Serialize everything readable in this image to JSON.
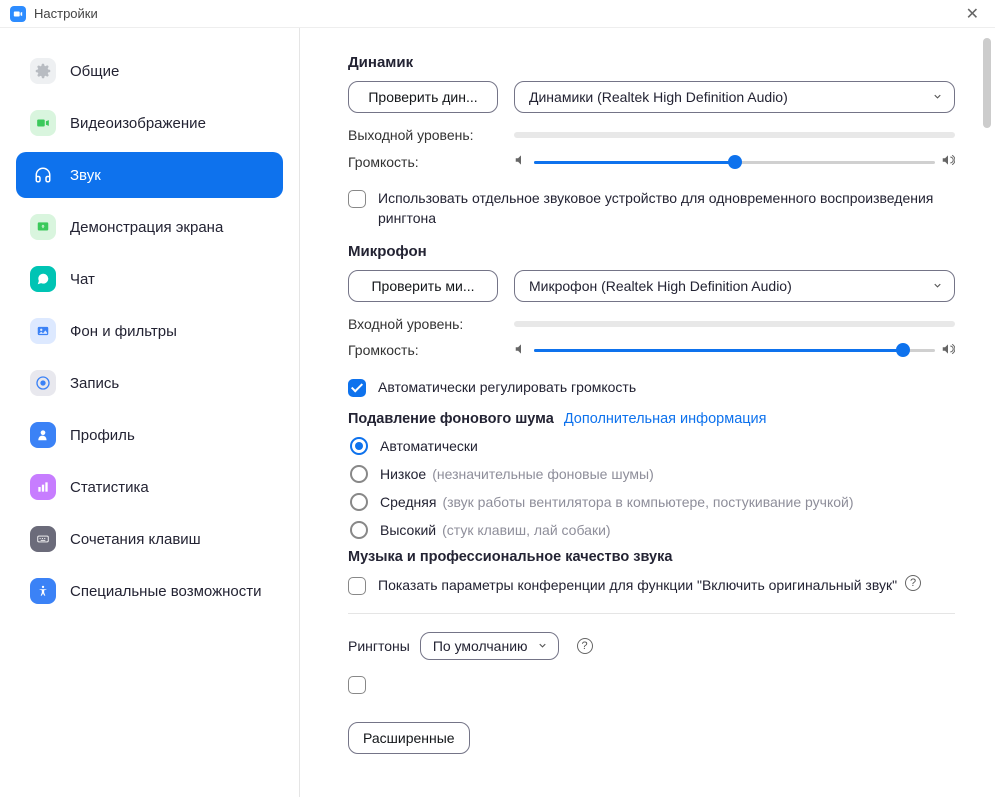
{
  "window": {
    "title": "Настройки"
  },
  "sidebar": {
    "items": [
      {
        "label": "Общие"
      },
      {
        "label": "Видеоизображение"
      },
      {
        "label": "Звук"
      },
      {
        "label": "Демонстрация экрана"
      },
      {
        "label": "Чат"
      },
      {
        "label": "Фон и фильтры"
      },
      {
        "label": "Запись"
      },
      {
        "label": "Профиль"
      },
      {
        "label": "Статистика"
      },
      {
        "label": "Сочетания клавиш"
      },
      {
        "label": "Специальные возможности"
      }
    ]
  },
  "speaker": {
    "title": "Динамик",
    "test_btn": "Проверить дин...",
    "device": "Динамики (Realtek High Definition Audio)",
    "output_level_label": "Выходной уровень:",
    "volume_label": "Громкость:",
    "volume_percent": 50,
    "separate_device_label": "Использовать отдельное звуковое устройство для одновременного воспроизведения рингтона"
  },
  "mic": {
    "title": "Микрофон",
    "test_btn": "Проверить ми...",
    "device": "Микрофон (Realtek High Definition Audio)",
    "input_level_label": "Входной уровень:",
    "volume_label": "Громкость:",
    "volume_percent": 92,
    "auto_adjust_label": "Автоматически регулировать громкость"
  },
  "noise": {
    "title": "Подавление фонового шума",
    "link": "Дополнительная информация",
    "options": {
      "auto": {
        "label": "Автоматически",
        "hint": ""
      },
      "low": {
        "label": "Низкое",
        "hint": "(незначительные фоновые шумы)"
      },
      "medium": {
        "label": "Средняя",
        "hint": "(звук работы вентилятора в компьютере, постукивание ручкой)"
      },
      "high": {
        "label": "Высокий",
        "hint": "(стук клавиш, лай собаки)"
      }
    }
  },
  "music": {
    "title": "Музыка и профессиональное качество звука",
    "option_label": "Показать параметры конференции для функции \"Включить оригинальный звук\""
  },
  "ringtone": {
    "label": "Рингтоны",
    "value": "По умолчанию"
  },
  "advanced_btn": "Расширенные"
}
